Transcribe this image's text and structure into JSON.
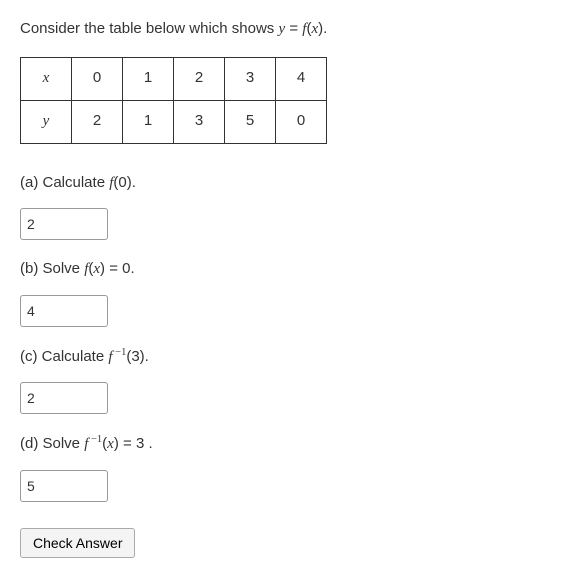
{
  "chart_data": {
    "type": "table",
    "title": "y = f(x)",
    "columns": [
      "x",
      "y"
    ],
    "rows": [
      {
        "x": 0,
        "y": 2
      },
      {
        "x": 1,
        "y": 1
      },
      {
        "x": 2,
        "y": 3
      },
      {
        "x": 3,
        "y": 5
      },
      {
        "x": 4,
        "y": 0
      }
    ]
  },
  "prompt": {
    "prefix": "Consider the table below which shows ",
    "eq_lhs": "y",
    "eq_eq": " = ",
    "eq_rhs_f": "f",
    "eq_rhs_paren_open": "(",
    "eq_rhs_var": "x",
    "eq_rhs_paren_close": ")",
    "suffix": "."
  },
  "table": {
    "row_x_label": "x",
    "row_y_label": "y",
    "x": [
      "0",
      "1",
      "2",
      "3",
      "4"
    ],
    "y": [
      "2",
      "1",
      "3",
      "5",
      "0"
    ]
  },
  "parts": {
    "a": {
      "label": "(a) Calculate ",
      "fn": "f",
      "arg": "(0)",
      "tail": ".",
      "value": "2"
    },
    "b": {
      "label": "(b) Solve ",
      "fn": "f",
      "paren_open": "(",
      "var": "x",
      "paren_close": ")",
      "eq": " = 0",
      "tail": ".",
      "value": "4"
    },
    "c": {
      "label": "(c) Calculate ",
      "fn": "f",
      "exp": " −1",
      "arg": "(3)",
      "tail": ".",
      "value": "2"
    },
    "d": {
      "label": "(d) Solve ",
      "fn": "f",
      "exp": " −1",
      "paren_open": "(",
      "var": "x",
      "paren_close": ")",
      "eq": " = 3",
      "tail": " .",
      "value": "5"
    }
  },
  "button": {
    "label": "Check Answer"
  }
}
